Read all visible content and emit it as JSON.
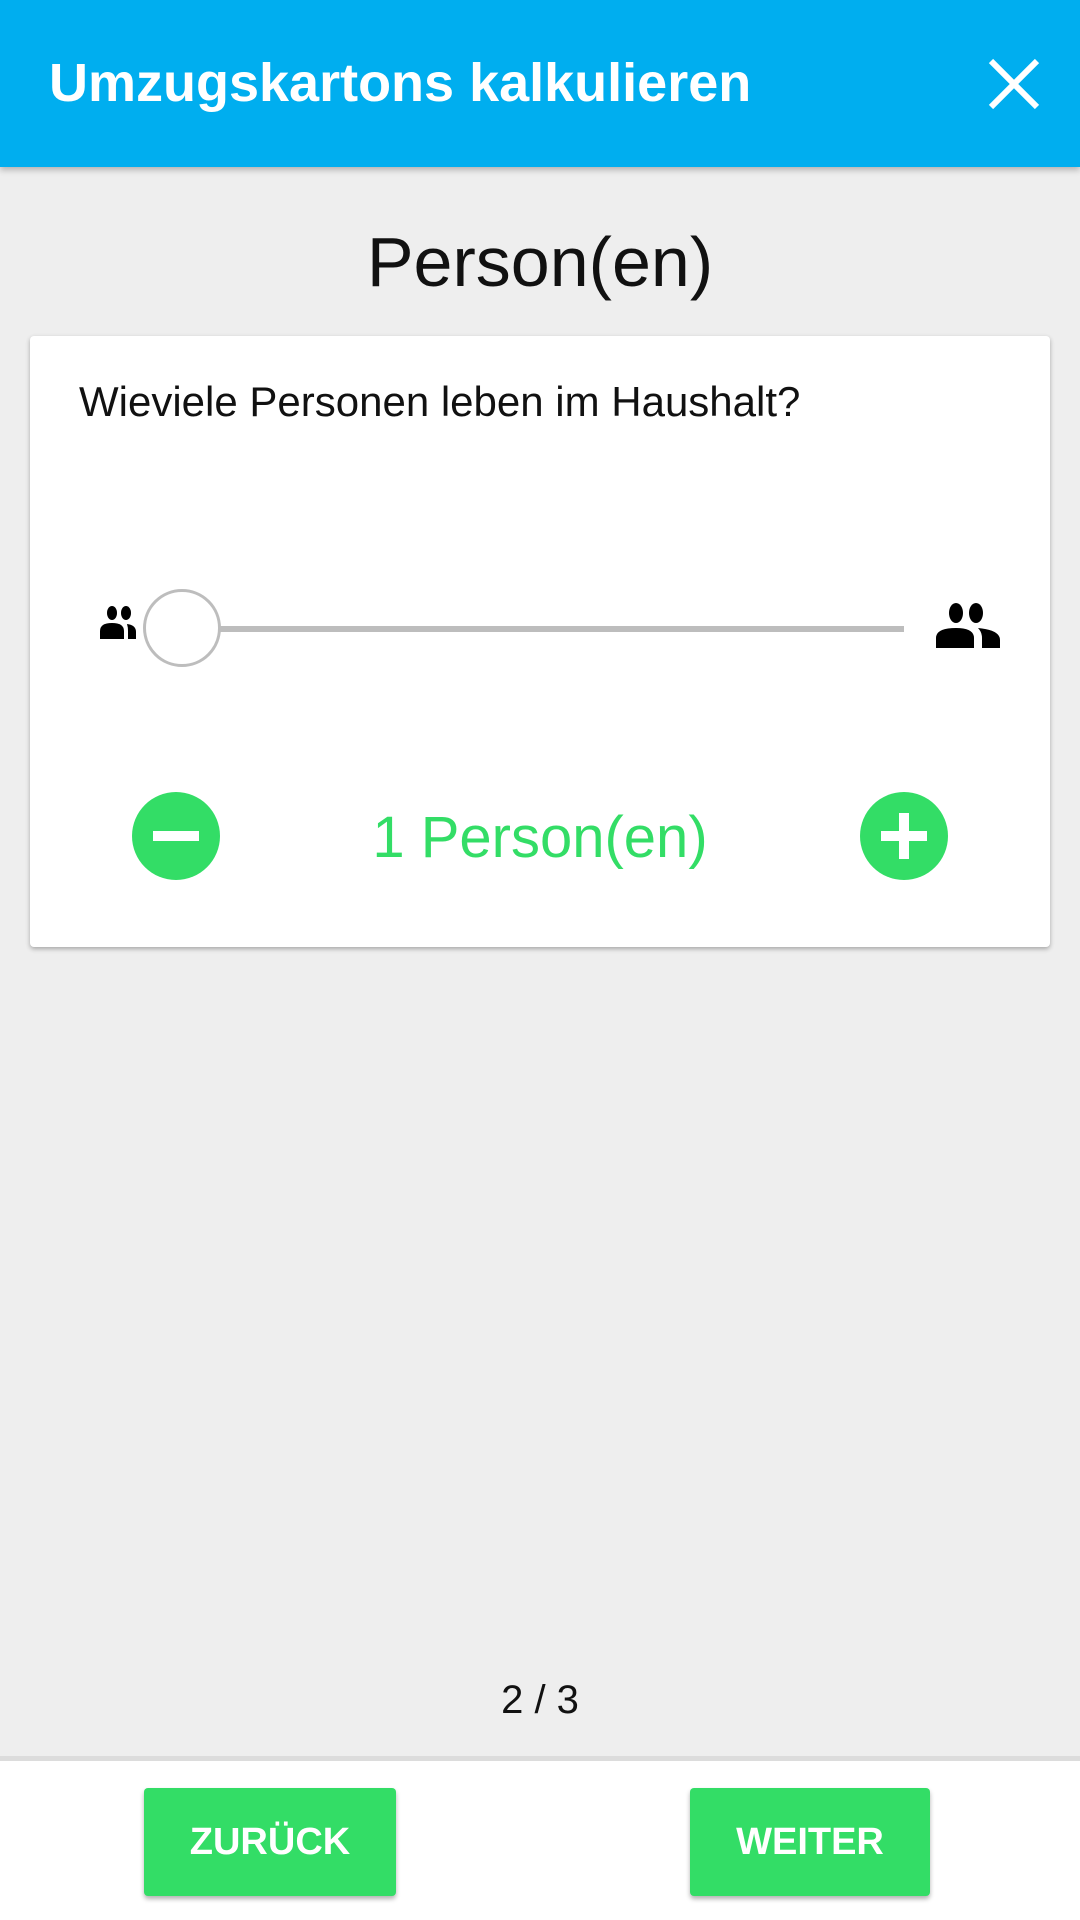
{
  "header": {
    "title": "Umzugskartons kalkulieren",
    "close_icon": "close-icon"
  },
  "page": {
    "heading": "Person(en)"
  },
  "card": {
    "question": "Wieviele Personen leben im Haushalt?",
    "slider": {
      "value": 1,
      "min": 1,
      "fraction": 0.0
    },
    "count_label": "1 Person(en)"
  },
  "pager": "2 / 3",
  "footer": {
    "back_label": "ZURÜCK",
    "next_label": "WEITER"
  },
  "colors": {
    "primary": "#00aeef",
    "accent": "#33dd66",
    "background": "#eeeeee"
  }
}
